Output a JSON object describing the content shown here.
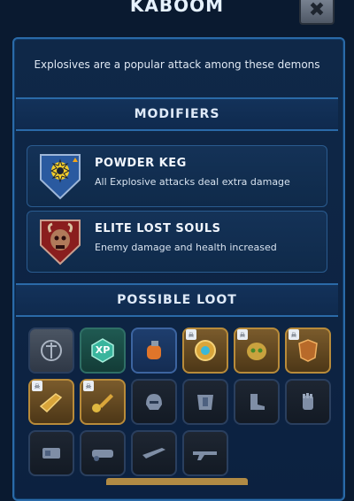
{
  "header": {
    "title": "KABOOM",
    "close_icon": "close-icon"
  },
  "description": "Explosives are a popular attack among these demons",
  "modifiers": {
    "section_title": "MODIFIERS",
    "items": [
      {
        "name": "POWDER KEG",
        "text": "All Explosive attacks deal extra damage",
        "icon": "explosion-shield-icon",
        "color": "#2a5aa0"
      },
      {
        "name": "ELITE LOST SOULS",
        "text": "Enemy damage and health increased",
        "icon": "demon-skull-shield-icon",
        "color": "#8a1e1e"
      }
    ]
  },
  "loot": {
    "section_title": "POSSIBLE LOOT",
    "rows": [
      [
        {
          "icon": "sigil-emblem-icon",
          "style": "gray"
        },
        {
          "icon": "xp-hex-icon",
          "style": "green",
          "label": "XP"
        },
        {
          "icon": "grenade-icon",
          "style": "blue"
        },
        {
          "icon": "mutation-shield-icon",
          "style": "gold"
        },
        {
          "icon": "demon-mask-icon",
          "style": "gold"
        },
        {
          "icon": "armor-ornament-icon",
          "style": "gold"
        }
      ],
      [
        {
          "icon": "gold-weapon-icon",
          "style": "gold"
        },
        {
          "icon": "gold-key-weapon-icon",
          "style": "gold"
        },
        {
          "icon": "helmet-icon",
          "style": "dark"
        },
        {
          "icon": "chest-armor-icon",
          "style": "dark"
        },
        {
          "icon": "boots-icon",
          "style": "dark"
        },
        {
          "icon": "gauntlet-icon",
          "style": "dark"
        }
      ],
      [
        {
          "icon": "heavy-weapon-icon",
          "style": "dark"
        },
        {
          "icon": "cannon-icon",
          "style": "dark"
        },
        {
          "icon": "rifle-icon",
          "style": "dark"
        },
        {
          "icon": "shotgun-icon",
          "style": "dark"
        }
      ]
    ]
  }
}
